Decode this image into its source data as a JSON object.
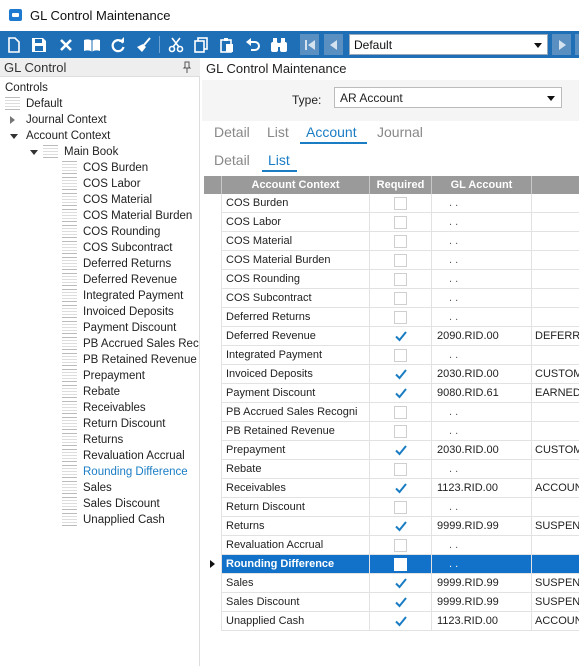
{
  "window": {
    "title": "GL Control Maintenance"
  },
  "toolbar": {
    "combo_value": "Default",
    "icons": [
      "new-icon",
      "save-icon",
      "delete-icon",
      "book-icon",
      "refresh-icon",
      "broom-icon",
      "cut-icon",
      "copy-icon",
      "paste-icon",
      "undo-icon",
      "binoculars-icon"
    ]
  },
  "left_panel": {
    "title": "GL Control",
    "tree": [
      {
        "label": "Controls"
      },
      {
        "label": "Default"
      },
      {
        "label": "Journal Context"
      },
      {
        "label": "Account Context"
      },
      {
        "label": "Main Book"
      },
      {
        "label": "COS Burden"
      },
      {
        "label": "COS Labor"
      },
      {
        "label": "COS Material"
      },
      {
        "label": "COS Material Burden"
      },
      {
        "label": "COS Rounding"
      },
      {
        "label": "COS Subcontract"
      },
      {
        "label": "Deferred Returns"
      },
      {
        "label": "Deferred Revenue"
      },
      {
        "label": "Integrated Payment"
      },
      {
        "label": "Invoiced Deposits"
      },
      {
        "label": "Payment Discount"
      },
      {
        "label": "PB Accrued Sales Rec"
      },
      {
        "label": "PB Retained Revenue"
      },
      {
        "label": "Prepayment"
      },
      {
        "label": "Rebate"
      },
      {
        "label": "Receivables"
      },
      {
        "label": "Return Discount"
      },
      {
        "label": "Returns"
      },
      {
        "label": "Revaluation Accrual"
      },
      {
        "label": "Rounding Difference"
      },
      {
        "label": "Sales"
      },
      {
        "label": "Sales Discount"
      },
      {
        "label": "Unapplied Cash"
      }
    ]
  },
  "main": {
    "title": "GL Control Maintenance",
    "type_label": "Type:",
    "type_value": "AR Account",
    "tabs_top": [
      "Detail",
      "List",
      "Account",
      "Journal"
    ],
    "tabs_sub": [
      "Detail",
      "List"
    ],
    "grid": {
      "headers": [
        "Account Context",
        "Required",
        "GL Account"
      ],
      "rows": [
        {
          "account": "COS Burden",
          "required": false,
          "gl": ". .",
          "desc": ""
        },
        {
          "account": "COS Labor",
          "required": false,
          "gl": ". .",
          "desc": ""
        },
        {
          "account": "COS Material",
          "required": false,
          "gl": ". .",
          "desc": ""
        },
        {
          "account": "COS Material Burden",
          "required": false,
          "gl": ". .",
          "desc": ""
        },
        {
          "account": "COS Rounding",
          "required": false,
          "gl": ". .",
          "desc": ""
        },
        {
          "account": "COS Subcontract",
          "required": false,
          "gl": ". .",
          "desc": ""
        },
        {
          "account": "Deferred Returns",
          "required": false,
          "gl": ". .",
          "desc": ""
        },
        {
          "account": "Deferred Revenue",
          "required": true,
          "gl": "2090.RID.00",
          "desc": "DEFERR"
        },
        {
          "account": "Integrated Payment",
          "required": false,
          "gl": ". .",
          "desc": ""
        },
        {
          "account": "Invoiced Deposits",
          "required": true,
          "gl": "2030.RID.00",
          "desc": "CUSTOM"
        },
        {
          "account": "Payment Discount",
          "required": true,
          "gl": "9080.RID.61",
          "desc": "EARNED"
        },
        {
          "account": "PB Accrued Sales Recogni",
          "required": false,
          "gl": ". .",
          "desc": ""
        },
        {
          "account": "PB Retained Revenue",
          "required": false,
          "gl": ". .",
          "desc": ""
        },
        {
          "account": "Prepayment",
          "required": true,
          "gl": "2030.RID.00",
          "desc": "CUSTOM"
        },
        {
          "account": "Rebate",
          "required": false,
          "gl": ". .",
          "desc": ""
        },
        {
          "account": "Receivables",
          "required": true,
          "gl": "1123.RID.00",
          "desc": "ACCOUN"
        },
        {
          "account": "Return Discount",
          "required": false,
          "gl": ". .",
          "desc": ""
        },
        {
          "account": "Returns",
          "required": true,
          "gl": "9999.RID.99",
          "desc": "SUSPEN"
        },
        {
          "account": "Revaluation Accrual",
          "required": false,
          "gl": ". .",
          "desc": ""
        },
        {
          "account": "Rounding Difference",
          "required": false,
          "gl": ". .",
          "desc": "",
          "current": true
        },
        {
          "account": "Sales",
          "required": true,
          "gl": "9999.RID.99",
          "desc": "SUSPEN"
        },
        {
          "account": "Sales Discount",
          "required": true,
          "gl": "9999.RID.99",
          "desc": "SUSPEN"
        },
        {
          "account": "Unapplied Cash",
          "required": true,
          "gl": "1123.RID.00",
          "desc": "ACCOUN"
        }
      ]
    }
  },
  "colors": {
    "toolbar": "#1f6fb6",
    "accent": "#1a7dc4",
    "selected_row": "#1272c9",
    "grid_header": "#9a9a9a"
  }
}
